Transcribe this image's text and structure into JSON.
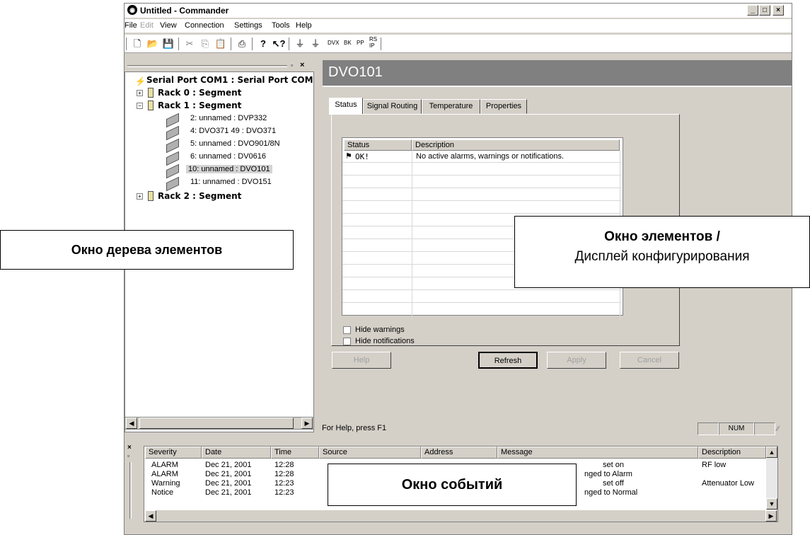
{
  "window": {
    "title": "Untitled - Commander",
    "buttons": [
      "_",
      "□",
      "×"
    ]
  },
  "menu": [
    "File",
    "Edit",
    "View",
    "Connection",
    "Settings",
    "Tools",
    "Help"
  ],
  "toolbar": {
    "text_buttons": [
      "DVX",
      "BK",
      "PP",
      "RS\nIP"
    ]
  },
  "tree": {
    "root": "Serial Port COM1 : Serial Port COM",
    "rack0": "Rack  0 : Segment",
    "rack1": "Rack  1 : Segment",
    "devices": [
      "2: unnamed : DVP332",
      "4: DVO371 49 : DVO371",
      "5: unnamed : DVO901/8N",
      "6: unnamed : DV0616",
      "10: unnamed : DVO101",
      "11: unnamed : DVO151"
    ],
    "rack2": "Rack  2 : Segment"
  },
  "element": {
    "title": "DVO101",
    "tabs": [
      "Status",
      "Signal Routing",
      "Temperature",
      "Properties"
    ],
    "grid_headers": [
      "Status",
      "Description"
    ],
    "grid_row": {
      "status": "OK!",
      "description": "No active alarms, warnings or notifications."
    },
    "checkboxes": [
      "Hide warnings",
      "Hide notifications"
    ],
    "buttons": {
      "help": "Help",
      "refresh": "Refresh",
      "apply": "Apply",
      "cancel": "Cancel"
    }
  },
  "statusbar": {
    "text": "For Help, press F1",
    "num": "NUM"
  },
  "events": {
    "headers": [
      "Severity",
      "Date",
      "Time",
      "Source",
      "Address",
      "Message",
      "Description"
    ],
    "rows": [
      [
        "ALARM",
        "Dec 21, 2001",
        "12:28",
        "",
        "",
        "set on",
        "RF low"
      ],
      [
        "ALARM",
        "Dec 21, 2001",
        "12:28",
        "",
        "",
        "nged to Alarm",
        ""
      ],
      [
        "Warning",
        "Dec 21, 2001",
        "12:23",
        "",
        "",
        "set off",
        "Attenuator Low"
      ],
      [
        "Notice",
        "Dec 21, 2001",
        "12:23",
        "",
        "",
        "nged to Normal",
        ""
      ]
    ]
  },
  "callouts": {
    "tree": "Окно дерева элементов",
    "elements_line1": "Окно элементов /",
    "elements_line2": "Дисплей конфигурирования",
    "events": "Окно событий"
  }
}
